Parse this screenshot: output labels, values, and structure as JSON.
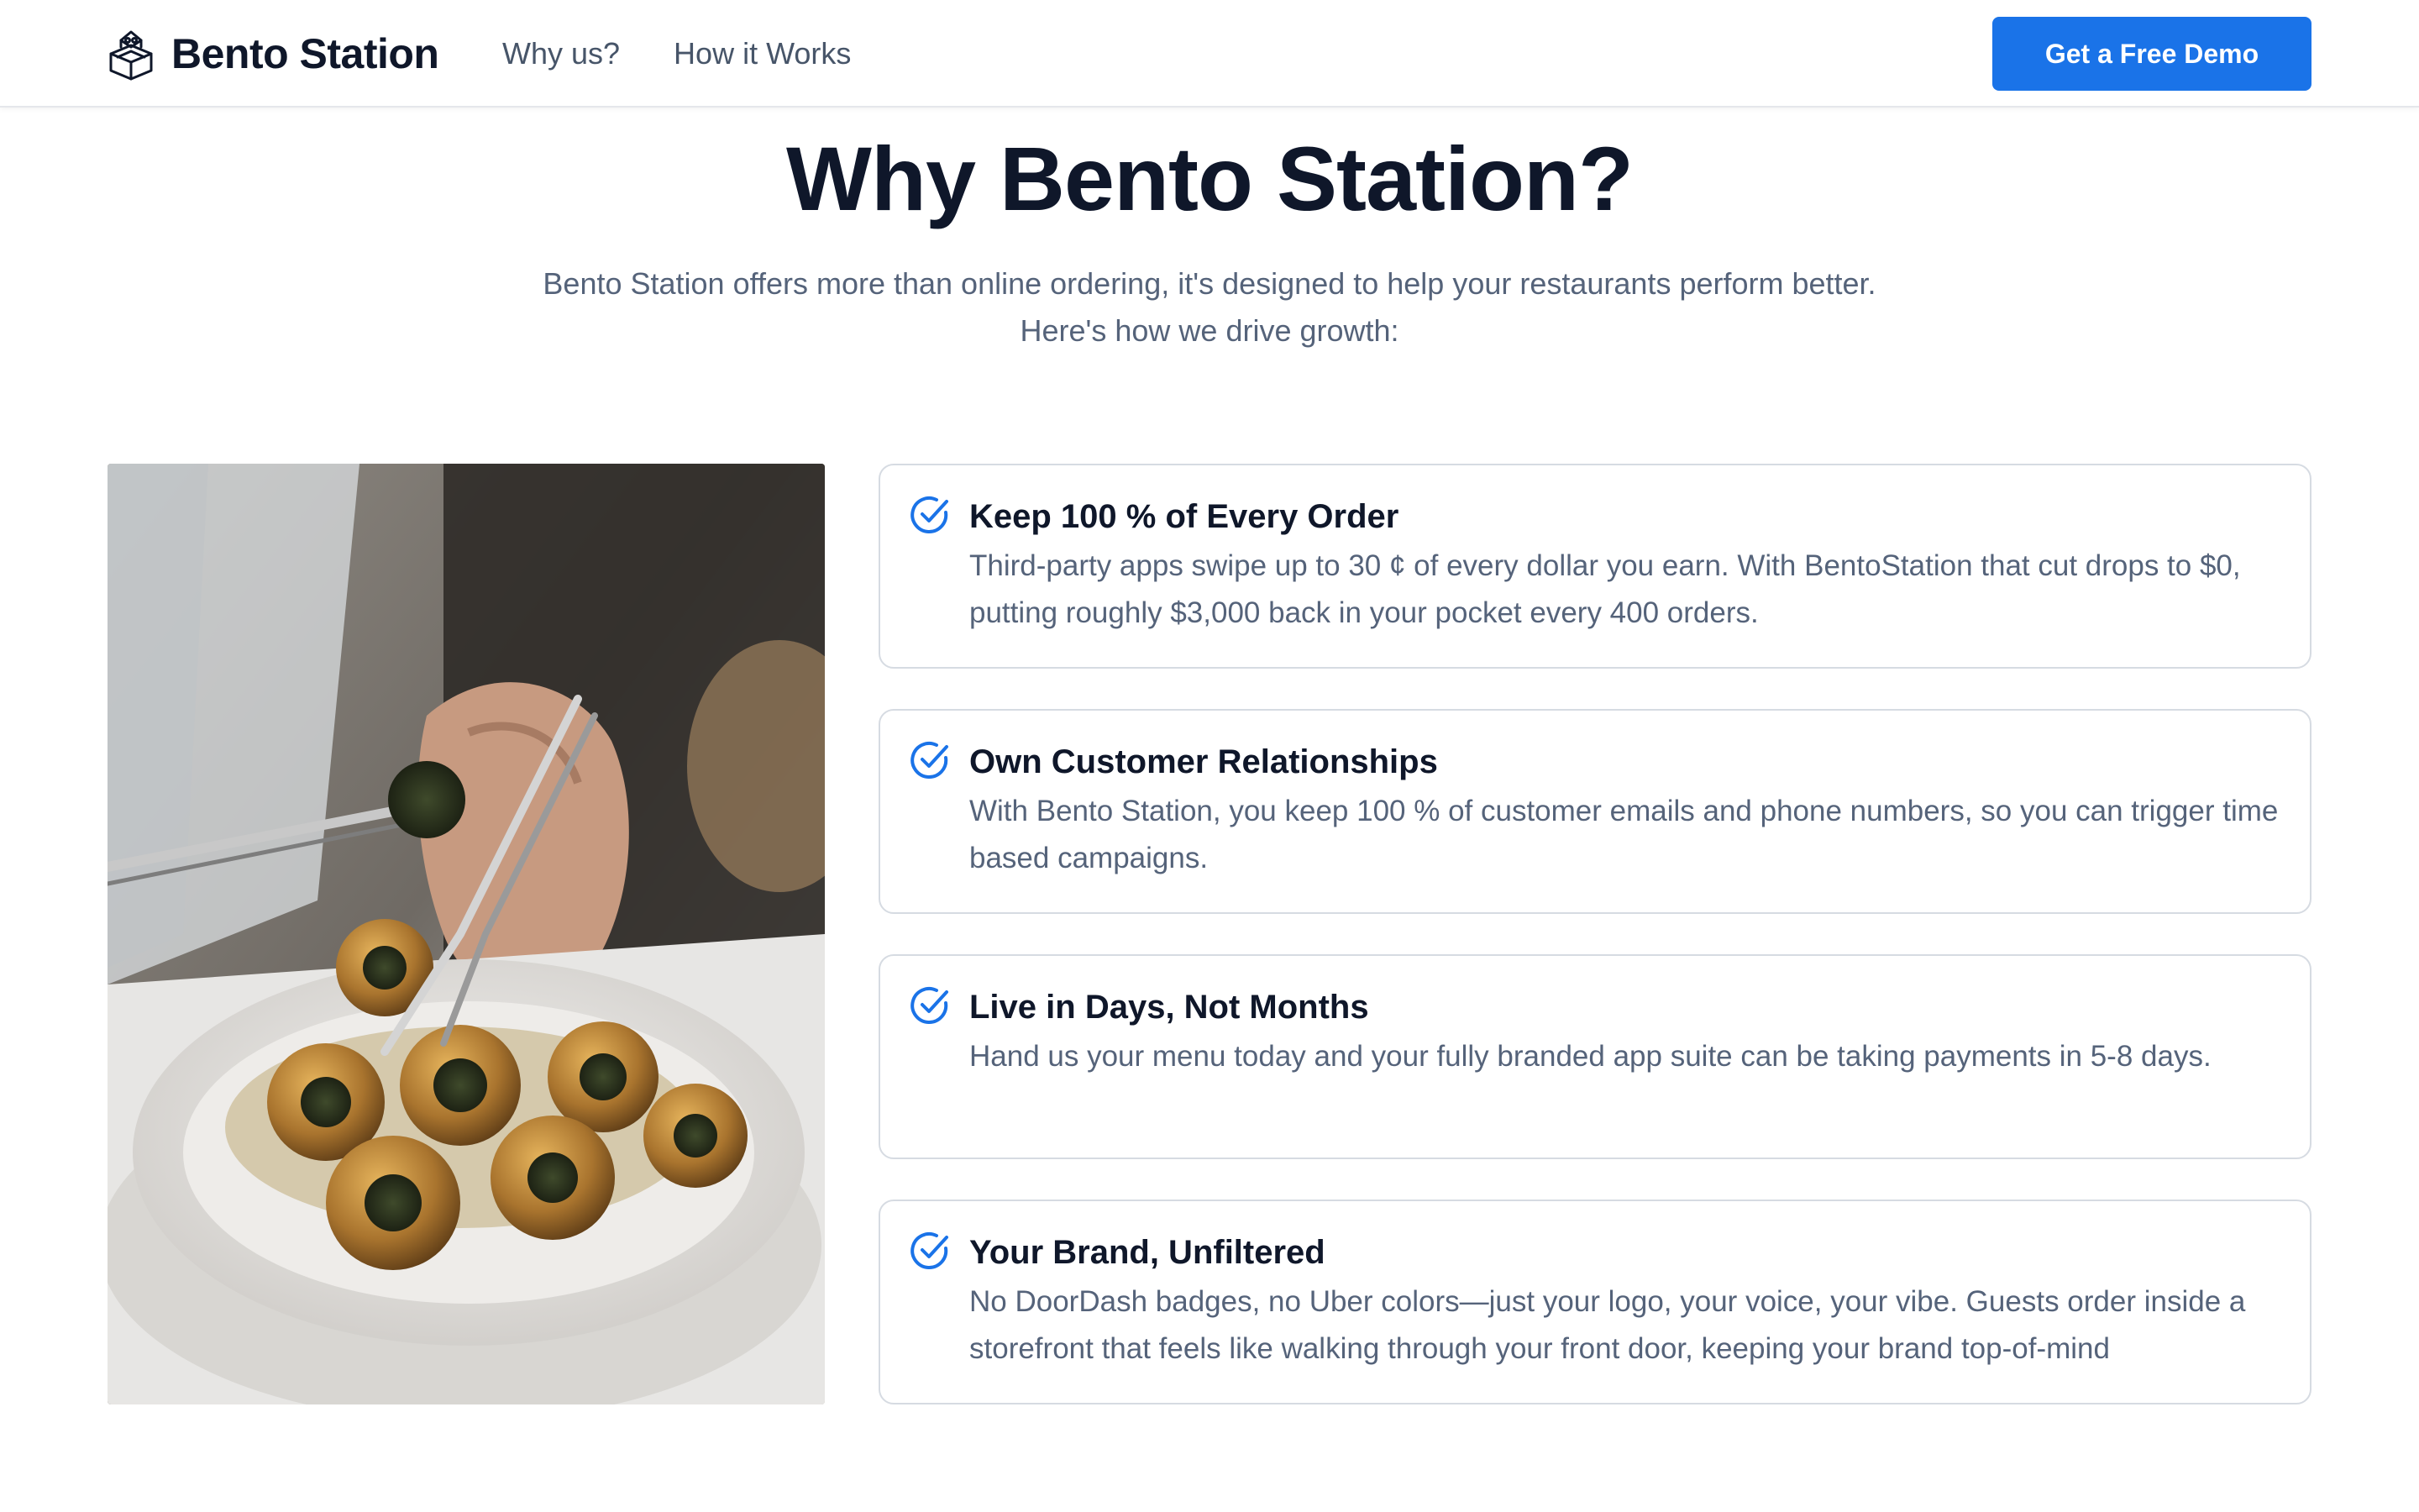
{
  "nav": {
    "brand_name": "Bento Station",
    "links": [
      "Why us?",
      "How it Works"
    ],
    "cta_label": "Get a Free Demo"
  },
  "hero": {
    "title": "Why Bento Station?",
    "subtitle": "Bento Station offers more than online ordering, it's designed to help your restaurants perform better. Here's how we drive growth:"
  },
  "features": [
    {
      "title": "Keep 100 % of Every Order",
      "text": "Third-party apps swipe up to 30 ¢ of every dollar you earn. With BentoStation that cut drops to $0, putting roughly $3,000 back in your pocket every 400 orders."
    },
    {
      "title": "Own Customer Relationships",
      "text": "With Bento Station, you keep 100 % of customer emails and phone numbers, so you can trigger time based campaigns."
    },
    {
      "title": "Live in Days, Not Months",
      "text": "Hand us your menu today and your fully branded app suite can be taking payments in 5-8 days."
    },
    {
      "title": "Your Brand, Unfiltered",
      "text": "No DoorDash badges, no Uber colors—just your logo, your voice, your vibe. Guests order inside a storefront that feels like walking through your front door, keeping your brand top-of-mind"
    }
  ],
  "icons": {
    "logo": "bento-box-icon",
    "feature_check": "check-circle-icon"
  },
  "colors": {
    "primary": "#1a73e8",
    "text_dark": "#0f172a",
    "text_muted": "#55637a",
    "card_border": "#d6dbe2"
  }
}
